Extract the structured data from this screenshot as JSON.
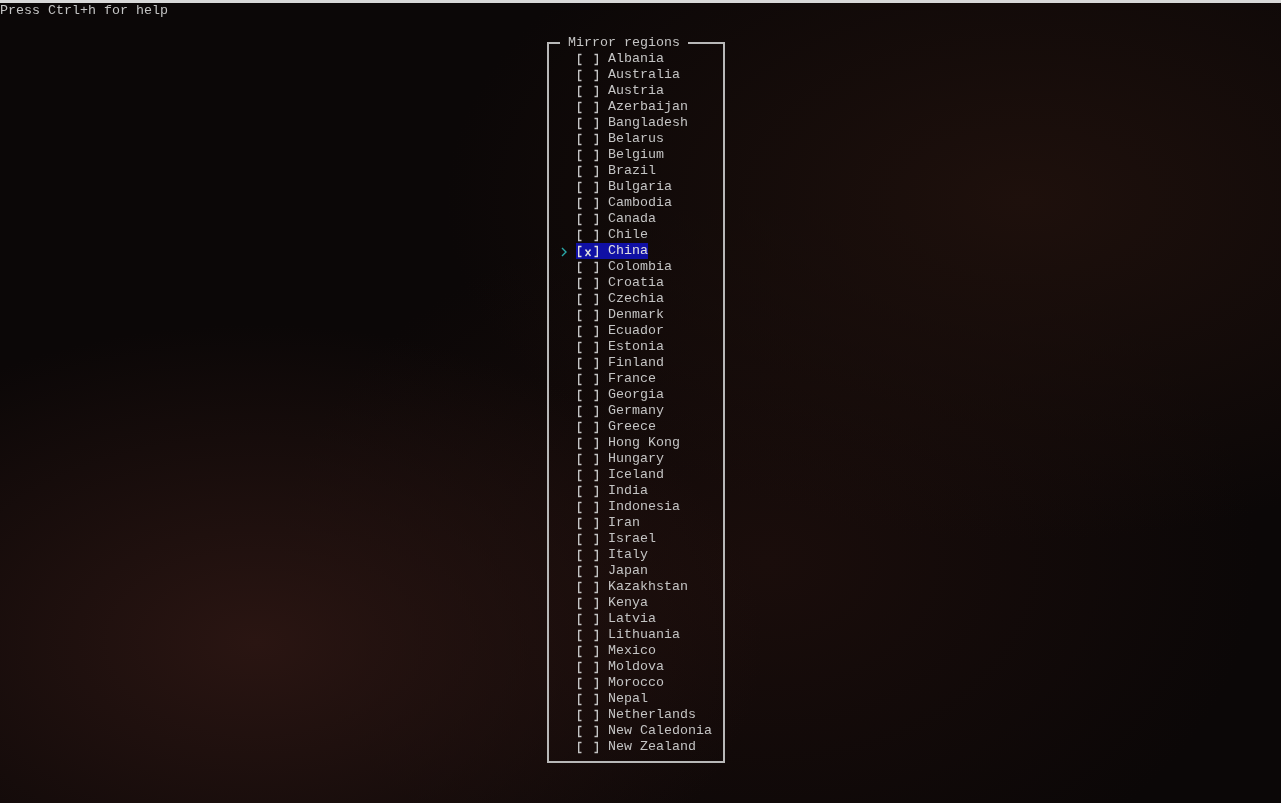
{
  "help_text": "Press Ctrl+h for help",
  "panel": {
    "title": "Mirror regions",
    "items": [
      {
        "label": "Albania",
        "checked": false,
        "selected": false
      },
      {
        "label": "Australia",
        "checked": false,
        "selected": false
      },
      {
        "label": "Austria",
        "checked": false,
        "selected": false
      },
      {
        "label": "Azerbaijan",
        "checked": false,
        "selected": false
      },
      {
        "label": "Bangladesh",
        "checked": false,
        "selected": false
      },
      {
        "label": "Belarus",
        "checked": false,
        "selected": false
      },
      {
        "label": "Belgium",
        "checked": false,
        "selected": false
      },
      {
        "label": "Brazil",
        "checked": false,
        "selected": false
      },
      {
        "label": "Bulgaria",
        "checked": false,
        "selected": false
      },
      {
        "label": "Cambodia",
        "checked": false,
        "selected": false
      },
      {
        "label": "Canada",
        "checked": false,
        "selected": false
      },
      {
        "label": "Chile",
        "checked": false,
        "selected": false
      },
      {
        "label": "China",
        "checked": true,
        "selected": true
      },
      {
        "label": "Colombia",
        "checked": false,
        "selected": false
      },
      {
        "label": "Croatia",
        "checked": false,
        "selected": false
      },
      {
        "label": "Czechia",
        "checked": false,
        "selected": false
      },
      {
        "label": "Denmark",
        "checked": false,
        "selected": false
      },
      {
        "label": "Ecuador",
        "checked": false,
        "selected": false
      },
      {
        "label": "Estonia",
        "checked": false,
        "selected": false
      },
      {
        "label": "Finland",
        "checked": false,
        "selected": false
      },
      {
        "label": "France",
        "checked": false,
        "selected": false
      },
      {
        "label": "Georgia",
        "checked": false,
        "selected": false
      },
      {
        "label": "Germany",
        "checked": false,
        "selected": false
      },
      {
        "label": "Greece",
        "checked": false,
        "selected": false
      },
      {
        "label": "Hong Kong",
        "checked": false,
        "selected": false
      },
      {
        "label": "Hungary",
        "checked": false,
        "selected": false
      },
      {
        "label": "Iceland",
        "checked": false,
        "selected": false
      },
      {
        "label": "India",
        "checked": false,
        "selected": false
      },
      {
        "label": "Indonesia",
        "checked": false,
        "selected": false
      },
      {
        "label": "Iran",
        "checked": false,
        "selected": false
      },
      {
        "label": "Israel",
        "checked": false,
        "selected": false
      },
      {
        "label": "Italy",
        "checked": false,
        "selected": false
      },
      {
        "label": "Japan",
        "checked": false,
        "selected": false
      },
      {
        "label": "Kazakhstan",
        "checked": false,
        "selected": false
      },
      {
        "label": "Kenya",
        "checked": false,
        "selected": false
      },
      {
        "label": "Latvia",
        "checked": false,
        "selected": false
      },
      {
        "label": "Lithuania",
        "checked": false,
        "selected": false
      },
      {
        "label": "Mexico",
        "checked": false,
        "selected": false
      },
      {
        "label": "Moldova",
        "checked": false,
        "selected": false
      },
      {
        "label": "Morocco",
        "checked": false,
        "selected": false
      },
      {
        "label": "Nepal",
        "checked": false,
        "selected": false
      },
      {
        "label": "Netherlands",
        "checked": false,
        "selected": false
      },
      {
        "label": "New Caledonia",
        "checked": false,
        "selected": false
      },
      {
        "label": "New Zealand",
        "checked": false,
        "selected": false
      }
    ]
  }
}
